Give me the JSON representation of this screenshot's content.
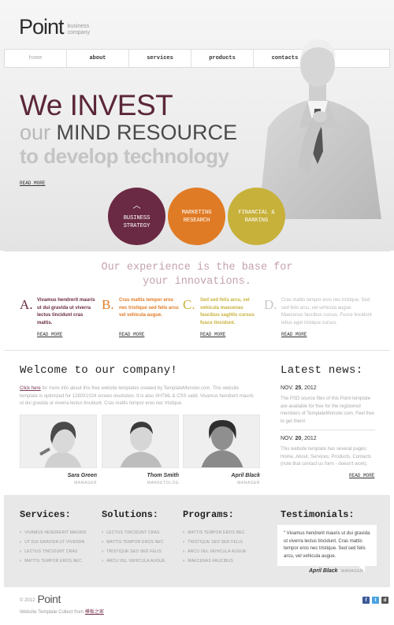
{
  "brand": {
    "logo": "Point",
    "sub1": "business",
    "sub2": "company"
  },
  "nav": [
    "home",
    "about",
    "services",
    "products",
    "contacts"
  ],
  "hero": {
    "line1": "We INVEST",
    "line2_light": "our ",
    "line2_dark": "MIND RESOURCE",
    "line3": "to develop technology",
    "read_more": "READ MORE"
  },
  "circles": [
    {
      "line1": "BUSINESS",
      "line2": "STRATEGY"
    },
    {
      "line1": "MARKETING",
      "line2": "RESEARCH"
    },
    {
      "line1": "FINANCIAL &",
      "line2": "BANKING"
    }
  ],
  "tagline": {
    "line1": "Our experience is the base for",
    "line2": "your innovations."
  },
  "features": [
    {
      "letter": "A.",
      "text": "Vivamus hendrerit mauris ut dui gravida ut viverra lectus tincidunt cras mattis.",
      "read_more": "READ MORE"
    },
    {
      "letter": "B.",
      "text": "Cras mattis tempor eros nec tristique sed felis arcu vel vehicula augue.",
      "read_more": "READ MORE"
    },
    {
      "letter": "C.",
      "text": "Sed sed felis arcu, vel vehicula maecenas faucibus sagittis cursus fusce tincidunt.",
      "read_more": "READ MORE"
    },
    {
      "letter": "D.",
      "text": "Cras mattis tempor eros nec tristique. Sed sed felis arcu, vel vehicula augue. Maecenas faucibus cursus. Fusce tincidunt tellus eget tristique cursus.",
      "read_more": "READ MORE"
    }
  ],
  "welcome": {
    "title": "Welcome to our company!",
    "link": "Click here",
    "text": " for more info about this free website templates created by TemplateMonster.com. This website template is optimized for 1280X1024 screen resolution. It is also XHTML & CSS valid. Vivamus hendrerit mauris ut dui gravida ut viverra lectus tincidunt. Cras mattis tempor eros nec tristique."
  },
  "team": [
    {
      "name": "Sara Green",
      "role": "MANAGER"
    },
    {
      "name": "Thom Smith",
      "role": "MARKETOLOG"
    },
    {
      "name": "April Black",
      "role": "MANAGER"
    }
  ],
  "news": {
    "title": "Latest news:",
    "items": [
      {
        "month": "NOV.",
        "day": "25",
        "year": ", 2012",
        "text": "The PSD source files of this Point template are available for free for the registered members of TemplateMonster.com. Feel free to get them!"
      },
      {
        "month": "NOV.",
        "day": "20",
        "year": ", 2012",
        "text": "This website template has several pages: Home, About, Services, Products, Contacts (note that contact us form - doesn't work)."
      }
    ],
    "read_more": "READ MORE"
  },
  "services": {
    "title": "Services:",
    "items": [
      "VIVAMUS HENDRERIT MAURIS",
      "UT DUI GRAVIDA UT VIVERRA",
      "LECTUS TINCIDUNT CRAS",
      "MATTIS TEMPOR EROS NEC"
    ]
  },
  "solutions": {
    "title": "Solutions:",
    "items": [
      "LECTUS TINCIDUNT CRAS",
      "MATTIS TEMPOR EROS NEC",
      "TRISTIQUE SED SED FELIS",
      "ARCU VEL VEHICULA AUGUE"
    ]
  },
  "programs": {
    "title": "Programs:",
    "items": [
      "MATTIS TEMPOR EROS NEC",
      "TRISTIQUE SED SED FELIS",
      "ARCU VEL VEHICULA AUGUE",
      "MAECENAS FAUCIBUS"
    ]
  },
  "testimonials": {
    "title": "Testimonials:",
    "text": "Vivamus hendrerit mauris ut dui gravida ut viverra lectus tincidunt. Cras mattis tempor eros nec tristique. Sed sed felis arcu, vel vehicula augue.",
    "author": "April Black",
    "role": "MANAGER"
  },
  "footer": {
    "year": "© 2012",
    "logo": "Point",
    "credit": "Website Template Collect from ",
    "credit_link": "模板之家"
  },
  "social": [
    "facebook-icon",
    "twitter-icon",
    "delicious-icon"
  ],
  "colors": {
    "plum": "#6b2a43",
    "orange": "#e07b25",
    "olive": "#c7b13a"
  }
}
